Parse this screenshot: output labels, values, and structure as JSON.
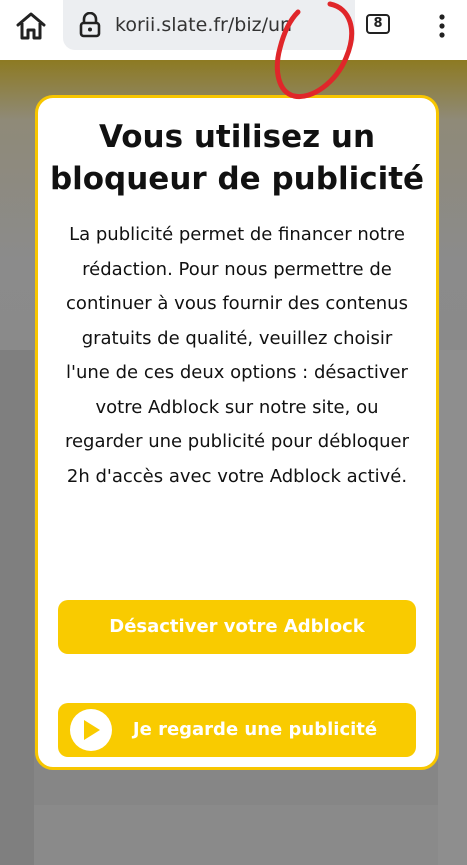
{
  "browser": {
    "url": "korii.slate.fr/biz/un",
    "tab_count": "8",
    "icons": [
      "home-icon",
      "lock-icon",
      "reader-mode-icon",
      "tabs-icon",
      "more-vert-icon"
    ],
    "annotation_color": "#e0262a"
  },
  "modal": {
    "title": "Vous utilisez un bloqueur de publicité",
    "body": "La publicité permet de financer notre rédaction. Pour nous permettre de continuer à vous fournir des contenus gratuits de qualité, veuillez choisir l'une de ces deux options : désactiver votre Adblock sur notre site, ou regarder une publicité pour débloquer 2h d'accès avec votre Adblock activé.",
    "disable_button": "Désactiver votre Adblock",
    "watch_button": "Je regarde une publicité",
    "accent_color": "#f9cb00"
  }
}
